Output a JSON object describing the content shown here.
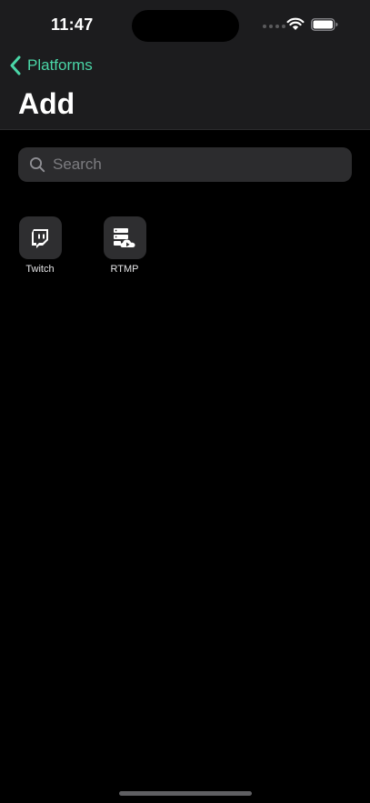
{
  "status_bar": {
    "time": "11:47"
  },
  "nav": {
    "back_label": "Platforms",
    "title": "Add"
  },
  "search": {
    "placeholder": "Search",
    "value": ""
  },
  "platforms": [
    {
      "label": "Twitch",
      "icon": "twitch-icon"
    },
    {
      "label": "RTMP",
      "icon": "rtmp-server-icon"
    }
  ],
  "colors": {
    "accent": "#4ad6a7",
    "header_bg": "#1c1c1e",
    "background": "#000000",
    "search_bg": "#2c2c2e",
    "tile_bg": "#2e2e30"
  }
}
